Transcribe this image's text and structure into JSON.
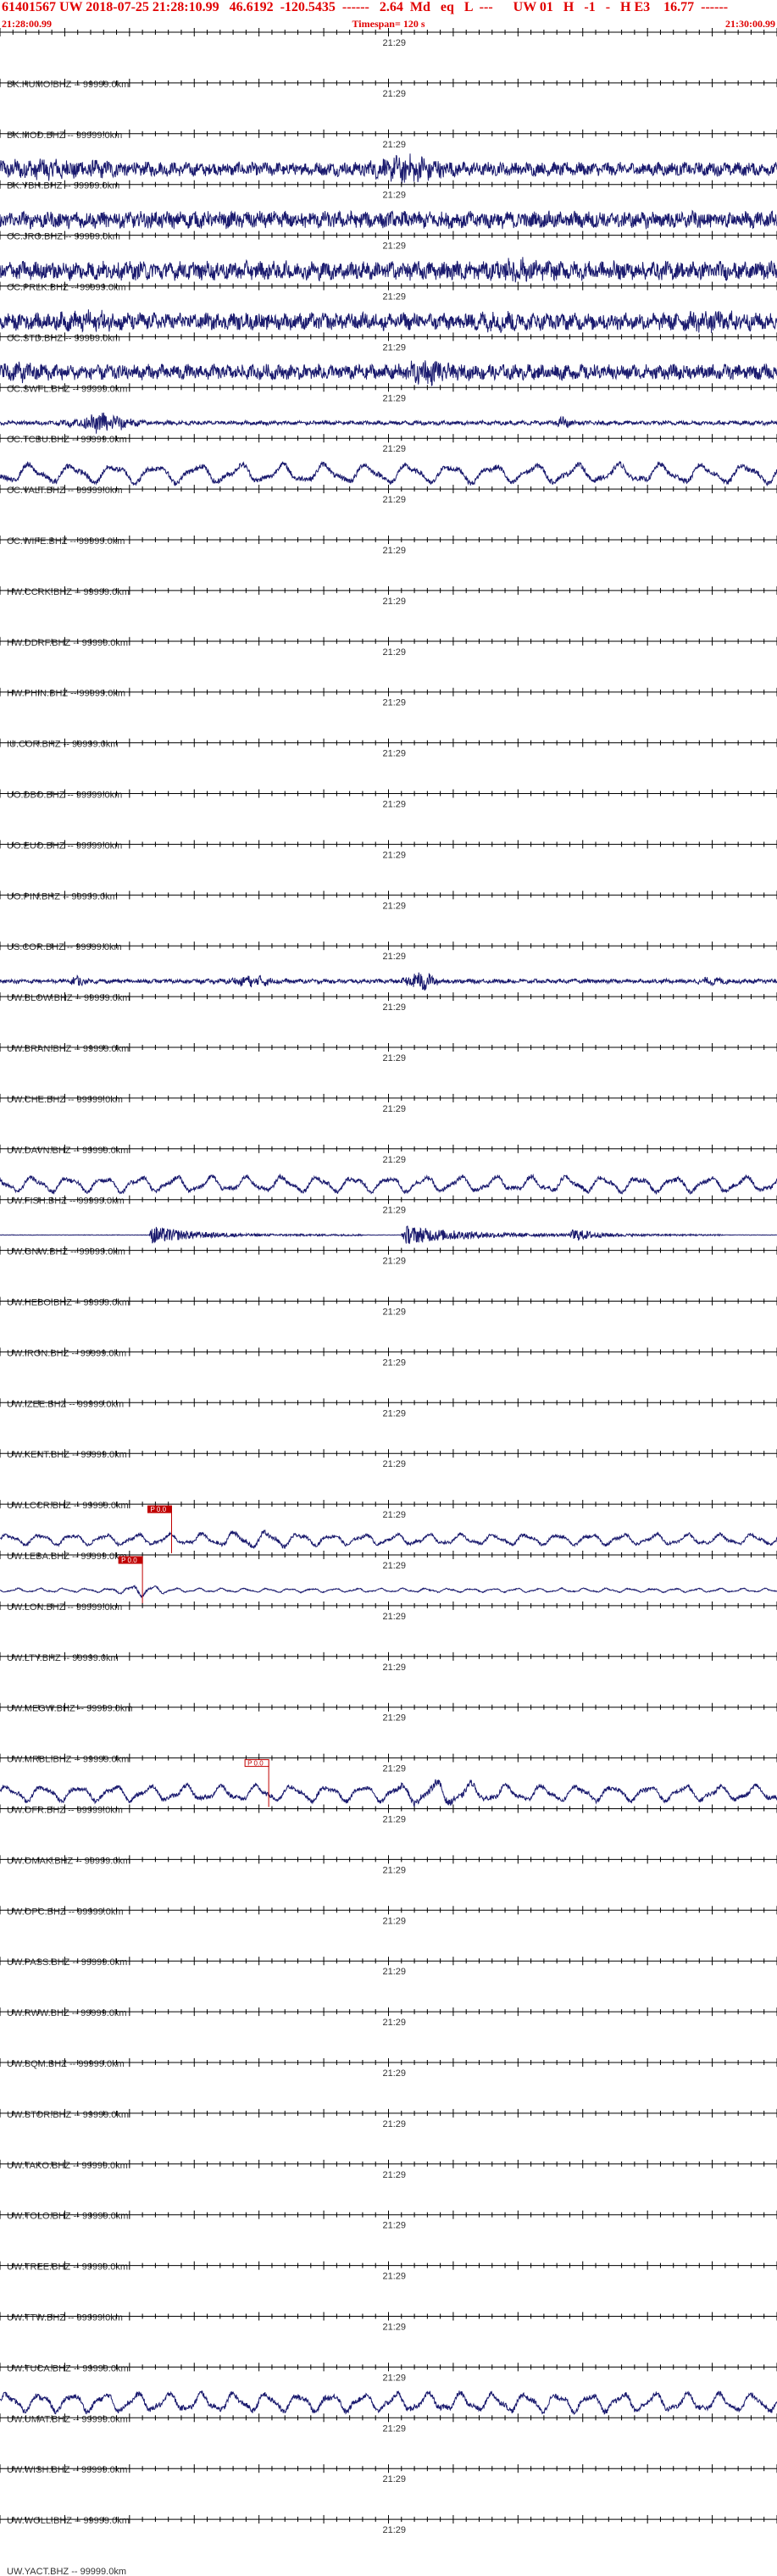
{
  "header": {
    "title": "61401567 UW 2018-07-25 21:28:10.99   46.6192  -120.5435  ------   2.64  Md   eq   L  ---      UW 01   H   -1   -   H E3    16.77  ------",
    "start_time": "21:28:00.99",
    "timespan": "Timespan= 120 s",
    "end_time": "21:30:00.99"
  },
  "colors": {
    "header_text": "#e00000",
    "trace": "#1a1a6e",
    "pick": "#c00000",
    "axis": "#000000",
    "label": "#333333"
  },
  "chart_data": {
    "type": "line",
    "title": "61401567 UW 2018-07-25 21:28:10.99",
    "x_unit": "s",
    "xlim": [
      0,
      120
    ],
    "mid_tick_label": "21:29",
    "channels": [
      {
        "label": "BK.HUMO.BHZ -- 99999.0km",
        "amp": 0,
        "style": "flat"
      },
      {
        "label": "BK.MOD.BHZ -- 99999.0km",
        "amp": 0,
        "style": "flat"
      },
      {
        "label": "BK.YBH.BHZ -- 99999.0km",
        "amp": 16,
        "style": "noise",
        "bursts": [
          [
            8,
            10,
            1.6
          ],
          [
            63,
            5,
            2.2
          ]
        ]
      },
      {
        "label": "CC.JRO.BHZ -- 99999.0km",
        "amp": 20,
        "style": "noise",
        "bursts": []
      },
      {
        "label": "CC.PRLK.BHZ -- 99999.0km",
        "amp": 22,
        "style": "noise",
        "bursts": [
          [
            80,
            3,
            1.4
          ]
        ]
      },
      {
        "label": "CC.STD.BHZ -- 99999.0km",
        "amp": 20,
        "style": "noise",
        "bursts": [
          [
            14,
            4,
            1.3
          ],
          [
            77,
            4,
            1.3
          ],
          [
            110,
            5,
            1.3
          ]
        ]
      },
      {
        "label": "CC.SWFL.BHZ -- 99999.0km",
        "amp": 18,
        "style": "noise",
        "bursts": [
          [
            3,
            4,
            1.4
          ],
          [
            66,
            3,
            1.8
          ]
        ]
      },
      {
        "label": "CC.TCBU.BHZ -- 99999.0km",
        "amp": 5,
        "style": "noise",
        "bursts": [
          [
            16,
            4,
            5
          ],
          [
            87,
            1,
            3
          ]
        ]
      },
      {
        "label": "CC.VALT.BHZ -- 99999.0km",
        "amp": 24,
        "style": "wave",
        "period": 6.5,
        "bursts": []
      },
      {
        "label": "CC.WIFE.BHZ -- 99999.0km",
        "amp": 0,
        "style": "flat"
      },
      {
        "label": "HW.CCRK.BHZ -- 99999.0km",
        "amp": 0,
        "style": "flat"
      },
      {
        "label": "HW.DDRF.BHZ -- 99999.0km",
        "amp": 0,
        "style": "flat"
      },
      {
        "label": "HW.PHIN.BHZ -- 99999.0km",
        "amp": 0,
        "style": "flat"
      },
      {
        "label": "IU.COR.BHZ -- 99999.0km",
        "amp": 0,
        "style": "flat"
      },
      {
        "label": "UO.DBO.BHZ -- 99999.0km",
        "amp": 0,
        "style": "flat"
      },
      {
        "label": "UO.EUO.BHZ -- 99999.0km",
        "amp": 0,
        "style": "flat"
      },
      {
        "label": "UO.PIN.BHZ -- 99999.0km",
        "amp": 0,
        "style": "flat"
      },
      {
        "label": "US.COR.BHZ -- 99999.0km",
        "amp": 0,
        "style": "flat"
      },
      {
        "label": "UW.BLOW.BHZ -- 99999.0km",
        "amp": 5,
        "style": "noise",
        "bursts": [
          [
            12,
            1,
            3
          ],
          [
            39,
            3,
            3
          ],
          [
            65,
            2,
            5
          ],
          [
            110,
            2,
            2
          ]
        ]
      },
      {
        "label": "UW.BRAN.BHZ -- 99999.0km",
        "amp": 0,
        "style": "flat"
      },
      {
        "label": "UW.CHE.BHZ -- 99999.0km",
        "amp": 0,
        "style": "flat"
      },
      {
        "label": "UW.DAVN.BHZ -- 99999.0km",
        "amp": 0,
        "style": "flat"
      },
      {
        "label": "UW.FISH.BHZ -- 99999.0km",
        "amp": 20,
        "style": "wave",
        "period": 5.5,
        "bursts": []
      },
      {
        "label": "UW.GNW.BHZ -- 99999.0km",
        "amp": 3,
        "style": "event",
        "bursts": [
          [
            23,
            6,
            12
          ],
          [
            62,
            9,
            12
          ],
          [
            88,
            3,
            9
          ]
        ]
      },
      {
        "label": "UW.HEBO.BHZ -- 99999.0km",
        "amp": 0,
        "style": "flat"
      },
      {
        "label": "UW.IRON.BHZ -- 99999.0km",
        "amp": 0,
        "style": "flat"
      },
      {
        "label": "UW.IZEE.BHZ -- 99999.0km",
        "amp": 0,
        "style": "flat"
      },
      {
        "label": "UW.KENT.BHZ -- 99999.0km",
        "amp": 0,
        "style": "flat"
      },
      {
        "label": "UW.LCCR.BHZ -- 99999.0km",
        "amp": 0,
        "style": "flat"
      },
      {
        "label": "UW.LEBA.BHZ -- 99999.0km",
        "amp": 14,
        "style": "wave",
        "period": 5,
        "bursts": [
          [
            39,
            6,
            1.6
          ]
        ],
        "pick": {
          "t": 26.5,
          "label": "P 0.0"
        }
      },
      {
        "label": "UW.LON.BHZ -- 99999.0km",
        "amp": 5,
        "style": "wave",
        "period": 3.5,
        "bursts": [
          [
            22,
            3,
            3
          ]
        ],
        "pick": {
          "t": 22,
          "label": "P 0.0"
        }
      },
      {
        "label": "UW.LTY.BHZ -- 99999.0km",
        "amp": 0,
        "style": "flat"
      },
      {
        "label": "UW.MEGW.BHZ -- 99999.0km",
        "amp": 0,
        "style": "flat"
      },
      {
        "label": "UW.MRBL.BHZ -- 99999.0km",
        "amp": 0,
        "style": "flat"
      },
      {
        "label": "UW.OFR.BHZ -- 99999.0km",
        "amp": 20,
        "style": "wave",
        "period": 5.5,
        "bursts": [
          [
            68,
            6,
            1.6
          ]
        ],
        "pick": {
          "t": 41.5,
          "label": "P 0.0",
          "hollow": true
        }
      },
      {
        "label": "UW.OMAK.BHZ -- 99999.0km",
        "amp": 0,
        "style": "flat"
      },
      {
        "label": "UW.OPC.BHZ -- 99999.0km",
        "amp": 0,
        "style": "flat"
      },
      {
        "label": "UW.PASS.BHZ -- 99999.0km",
        "amp": 0,
        "style": "flat"
      },
      {
        "label": "UW.RWW.BHZ -- 99999.0km",
        "amp": 0,
        "style": "flat"
      },
      {
        "label": "UW.SQM.BHZ -- 99999.0km",
        "amp": 0,
        "style": "flat"
      },
      {
        "label": "UW.STOR.BHZ -- 99999.0km",
        "amp": 0,
        "style": "flat"
      },
      {
        "label": "UW.TAKO.BHZ -- 99999.0km",
        "amp": 0,
        "style": "flat"
      },
      {
        "label": "UW.TOLO.BHZ -- 99999.0km",
        "amp": 0,
        "style": "flat"
      },
      {
        "label": "UW.TREE.BHZ -- 99999.0km",
        "amp": 0,
        "style": "flat"
      },
      {
        "label": "UW.TTW.BHZ -- 99999.0km",
        "amp": 0,
        "style": "flat"
      },
      {
        "label": "UW.TUCA.BHZ -- 99999.0km",
        "amp": 0,
        "style": "flat"
      },
      {
        "label": "UW.UMAT.BHZ -- 99999.0km",
        "amp": 24,
        "style": "wave",
        "period": 5,
        "bursts": []
      },
      {
        "label": "UW.WISH.BHZ -- 99999.0km",
        "amp": 0,
        "style": "flat"
      },
      {
        "label": "UW.WOLL.BHZ -- 99999.0km",
        "amp": 0,
        "style": "flat"
      },
      {
        "label": "UW.YACT.BHZ -- 99999.0km",
        "amp": 0,
        "style": "flat"
      }
    ]
  }
}
